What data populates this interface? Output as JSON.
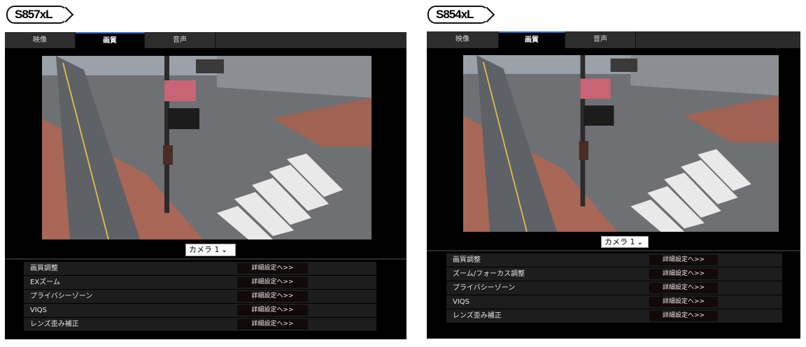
{
  "badges": {
    "left": "S857xL",
    "right": "S854xL"
  },
  "left": {
    "tabs": [
      {
        "label": "映像",
        "active": false
      },
      {
        "label": "画質",
        "active": true
      },
      {
        "label": "音声",
        "active": false
      }
    ],
    "camera_select": "カメラ 1",
    "settings_rows": [
      {
        "label": "画質調整",
        "button": "詳細設定へ>>"
      },
      {
        "label": "EXズーム",
        "button": "詳細設定へ>>"
      },
      {
        "label": "プライバシーゾーン",
        "button": "詳細設定へ>>"
      },
      {
        "label": "VIQS",
        "button": "詳細設定へ>>"
      },
      {
        "label": "レンズ歪み補正",
        "button": "詳細設定へ>>"
      }
    ]
  },
  "right": {
    "tabs": [
      {
        "label": "映像",
        "active": false
      },
      {
        "label": "画質",
        "active": true
      },
      {
        "label": "音声",
        "active": false
      }
    ],
    "camera_select": "カメラ 1",
    "settings_rows": [
      {
        "label": "画質調整",
        "button": "詳細設定へ>>"
      },
      {
        "label": "ズーム/フォーカス調整",
        "button": "詳細設定へ>>"
      },
      {
        "label": "プライバシーゾーン",
        "button": "詳細設定へ>>"
      },
      {
        "label": "VIQS",
        "button": "詳細設定へ>>"
      },
      {
        "label": "レンズ歪み補正",
        "button": "詳細設定へ>>"
      }
    ]
  },
  "colors": {
    "active_tab_accent": "#2f6fd6",
    "panel_bg": "#000000",
    "row_bg": "#1d1d1d"
  }
}
